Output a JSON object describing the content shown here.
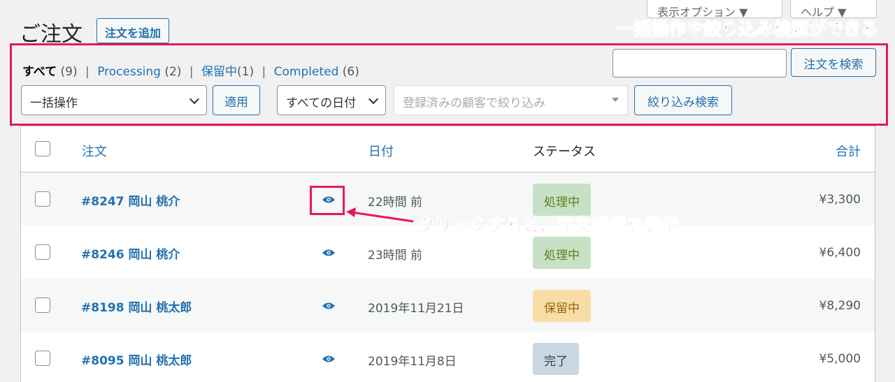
{
  "screen_tabs": {
    "options": "表示オプション ▼",
    "help": "ヘルプ ▼"
  },
  "page": {
    "title": "ご注文",
    "add_new": "注文を追加"
  },
  "annotations": {
    "top": "一括操作や絞り込み検索ができる",
    "click": "クリックすると、注文情報を表示",
    "color": "#e8175d"
  },
  "status_links": [
    {
      "label": "すべて",
      "count": "(9)"
    },
    {
      "label": "Processing",
      "count": "(2)"
    },
    {
      "label": "保留中",
      "count": "(1)"
    },
    {
      "label": "Completed",
      "count": "(6)"
    }
  ],
  "search": {
    "value": "",
    "button": "注文を検索"
  },
  "filters": {
    "bulk_action": "一括操作",
    "apply": "適用",
    "date": "すべての日付",
    "customer_placeholder": "登録済みの顧客で絞り込み",
    "filter_button": "絞り込み検索"
  },
  "table": {
    "headers": {
      "order": "注文",
      "date": "日付",
      "status": "ステータス",
      "total": "合計"
    },
    "rows": [
      {
        "order": "#8247 岡山 桃介",
        "date": "22時間 前",
        "status": "処理中",
        "status_type": "processing",
        "total": "¥3,300"
      },
      {
        "order": "#8246 岡山 桃介",
        "date": "23時間 前",
        "status": "処理中",
        "status_type": "processing",
        "total": "¥6,400"
      },
      {
        "order": "#8198 岡山 桃太郎",
        "date": "2019年11月21日",
        "status": "保留中",
        "status_type": "onhold",
        "total": "¥8,290"
      },
      {
        "order": "#8095 岡山 桃太郎",
        "date": "2019年11月8日",
        "status": "完了",
        "status_type": "completed",
        "total": "¥5,000"
      }
    ]
  },
  "colors": {
    "link": "#2271b1",
    "processing_bg": "#c6e1c6",
    "onhold_bg": "#f8dda7",
    "completed_bg": "#c8d7e1"
  },
  "icons": {
    "preview": "eye-icon"
  }
}
